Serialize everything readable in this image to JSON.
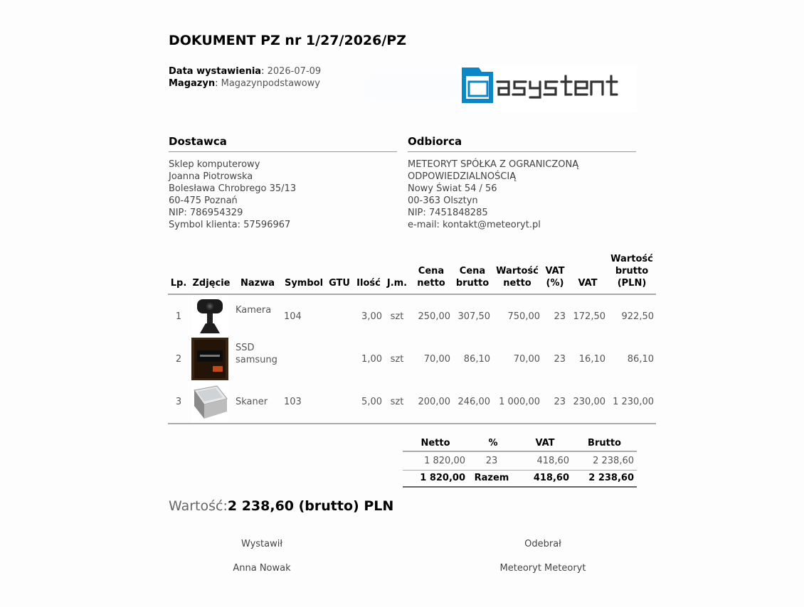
{
  "document": {
    "title": "DOKUMENT PZ nr 1/27/2026/PZ",
    "issue_date_label": "Data wystawienia",
    "issue_date": "2026-07-09",
    "warehouse_label": "Magazyn",
    "warehouse": "Magazynpodstawowy",
    "logo_text": "asystent",
    "logo_color": "#0b86c8"
  },
  "supplier": {
    "heading": "Dostawca",
    "lines": [
      "Sklep komputerowy",
      "Joanna Piotrowska",
      "Bolesława Chrobrego 35/13",
      "60-475 Poznań",
      "NIP: 786954329",
      "Symbol klienta: 57596967"
    ]
  },
  "recipient": {
    "heading": "Odbiorca",
    "lines": [
      "METEORYT SPÓŁKA Z OGRANICZONĄ",
      "ODPOWIEDZIALNOŚCIĄ",
      "Nowy Świat 54 / 56",
      "00-363 Olsztyn",
      "NIP: 7451848285",
      "e-mail: kontakt@meteoryt.pl"
    ]
  },
  "items_table": {
    "headers": {
      "lp": "Lp.",
      "photo": "Zdjęcie",
      "name": "Nazwa",
      "symbol": "Symbol",
      "gtu": "GTU",
      "qty": "Ilość",
      "unit": "J.m.",
      "net_price_1": "Cena",
      "net_price_2": "netto",
      "gross_price_1": "Cena",
      "gross_price_2": "brutto",
      "net_value_1": "Wartość",
      "net_value_2": "netto",
      "vat_pct_1": "VAT",
      "vat_pct_2": "(%)",
      "vat": "VAT",
      "gross_value_1": "Wartość",
      "gross_value_2": "brutto",
      "gross_value_3": "(PLN)"
    },
    "rows": [
      {
        "lp": "1",
        "photo": "webcam-photo",
        "name": "Kamera",
        "symbol": "104",
        "gtu": "",
        "qty": "3,00",
        "unit": "szt",
        "net_price": "250,00",
        "gross_price": "307,50",
        "net_value": "750,00",
        "vat_pct": "23",
        "vat": "172,50",
        "gross_value": "922,50"
      },
      {
        "lp": "2",
        "photo": "ssd-photo",
        "name": "SSD samsung",
        "symbol": "",
        "gtu": "",
        "qty": "1,00",
        "unit": "szt",
        "net_price": "70,00",
        "gross_price": "86,10",
        "net_value": "70,00",
        "vat_pct": "23",
        "vat": "16,10",
        "gross_value": "86,10"
      },
      {
        "lp": "3",
        "photo": "scanner-photo",
        "name": "Skaner",
        "symbol": "103",
        "gtu": "",
        "qty": "5,00",
        "unit": "szt",
        "net_price": "200,00",
        "gross_price": "246,00",
        "net_value": "1 000,00",
        "vat_pct": "23",
        "vat": "230,00",
        "gross_value": "1 230,00"
      }
    ]
  },
  "summary": {
    "headers": {
      "net": "Netto",
      "pct": "%",
      "vat": "VAT",
      "gross": "Brutto"
    },
    "row": {
      "net": "1 820,00",
      "pct": "23",
      "vat": "418,60",
      "gross": "2 238,60"
    },
    "total": {
      "net": "1 820,00",
      "label": "Razem",
      "vat": "418,60",
      "gross": "2 238,60"
    }
  },
  "value": {
    "label": "Wartość:",
    "amount": "2 238,60 (brutto) PLN"
  },
  "signatures": {
    "issued_label": "Wystawił",
    "issued_by": "Anna Nowak",
    "received_label": "Odebrał",
    "received_by": "Meteoryt Meteoryt"
  }
}
